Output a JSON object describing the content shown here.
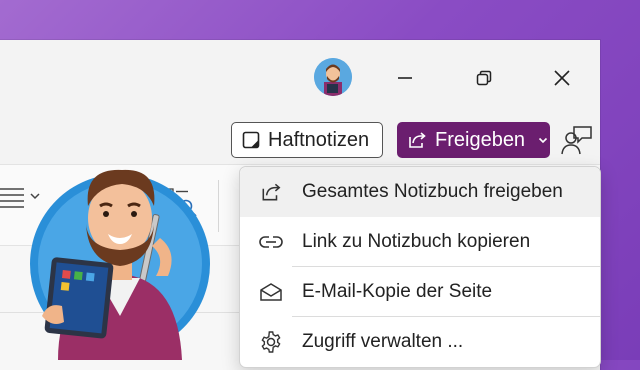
{
  "titlebar": {
    "profile_avatar": "user-avatar",
    "controls": [
      "minimize-icon",
      "restore-icon",
      "close-icon"
    ]
  },
  "commandbar": {
    "sticky_notes_label": "Haftnotizen",
    "share_label": "Freigeben",
    "share_color": "#6b1e6f"
  },
  "share_menu": {
    "items": [
      {
        "label": "Gesamtes Notizbuch freigeben",
        "icon": "share-icon"
      },
      {
        "label": "Link zu Notizbuch kopieren",
        "icon": "link-icon"
      },
      {
        "label": "E-Mail-Kopie der Seite",
        "icon": "mail-icon"
      },
      {
        "label": "Zugriff verwalten ...",
        "icon": "gear-icon"
      }
    ]
  },
  "background_color": "#8a4cc4"
}
